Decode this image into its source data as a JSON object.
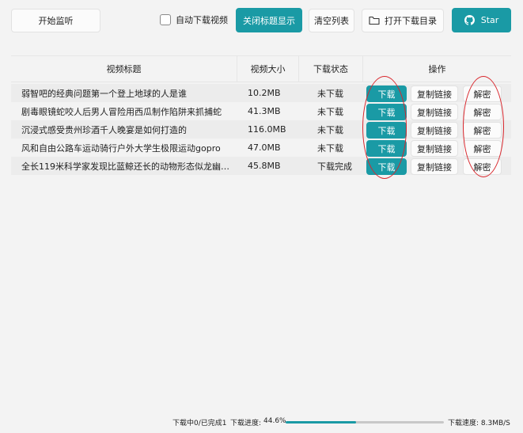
{
  "toolbar": {
    "monitor_label": "开始监听",
    "auto_download_label": "自动下载视频",
    "auto_download_checked": false,
    "title_toggle_label": "关闭标题显示",
    "clear_label": "清空列表",
    "open_dir_label": "打开下载目录",
    "star_label": "Star"
  },
  "table": {
    "headers": [
      "视频标题",
      "视频大小",
      "下载状态",
      "操作"
    ],
    "rows": [
      {
        "title": "弱智吧的经典问题第一个登上地球的人是谁",
        "size": "10.2MB",
        "status": "未下载",
        "download": "下载",
        "copy": "复制链接",
        "decrypt": "解密"
      },
      {
        "title": "剧毒眼镜蛇咬人后男人冒险用西瓜制作陷阱来抓捕蛇",
        "size": "41.3MB",
        "status": "未下载",
        "download": "下载",
        "copy": "复制链接",
        "decrypt": "解密"
      },
      {
        "title": "沉浸式感受贵州珍酒千人晚宴是如何打造的",
        "size": "116.0MB",
        "status": "未下载",
        "download": "下载",
        "copy": "复制链接",
        "decrypt": "解密"
      },
      {
        "title": "风和自由公路车运动骑行户外大学生极限运动gopro",
        "size": "47.0MB",
        "status": "未下载",
        "download": "下载",
        "copy": "复制链接",
        "decrypt": "解密"
      },
      {
        "title": "全长119米科学家发现比蓝鲸还长的动物形态似龙幽居深…",
        "size": "45.8MB",
        "status": "下载完成",
        "download": "下载",
        "copy": "复制链接",
        "decrypt": "解密"
      }
    ]
  },
  "status_bar": {
    "counts": "下载中0/已完成1",
    "progress_label": "下载进度:",
    "progress_value": "44.6%",
    "progress_fraction": 0.446,
    "speed": "下载速度: 8.3MB/S"
  },
  "colors": {
    "accent": "#1a9aa5",
    "annotation": "#d9262c"
  }
}
